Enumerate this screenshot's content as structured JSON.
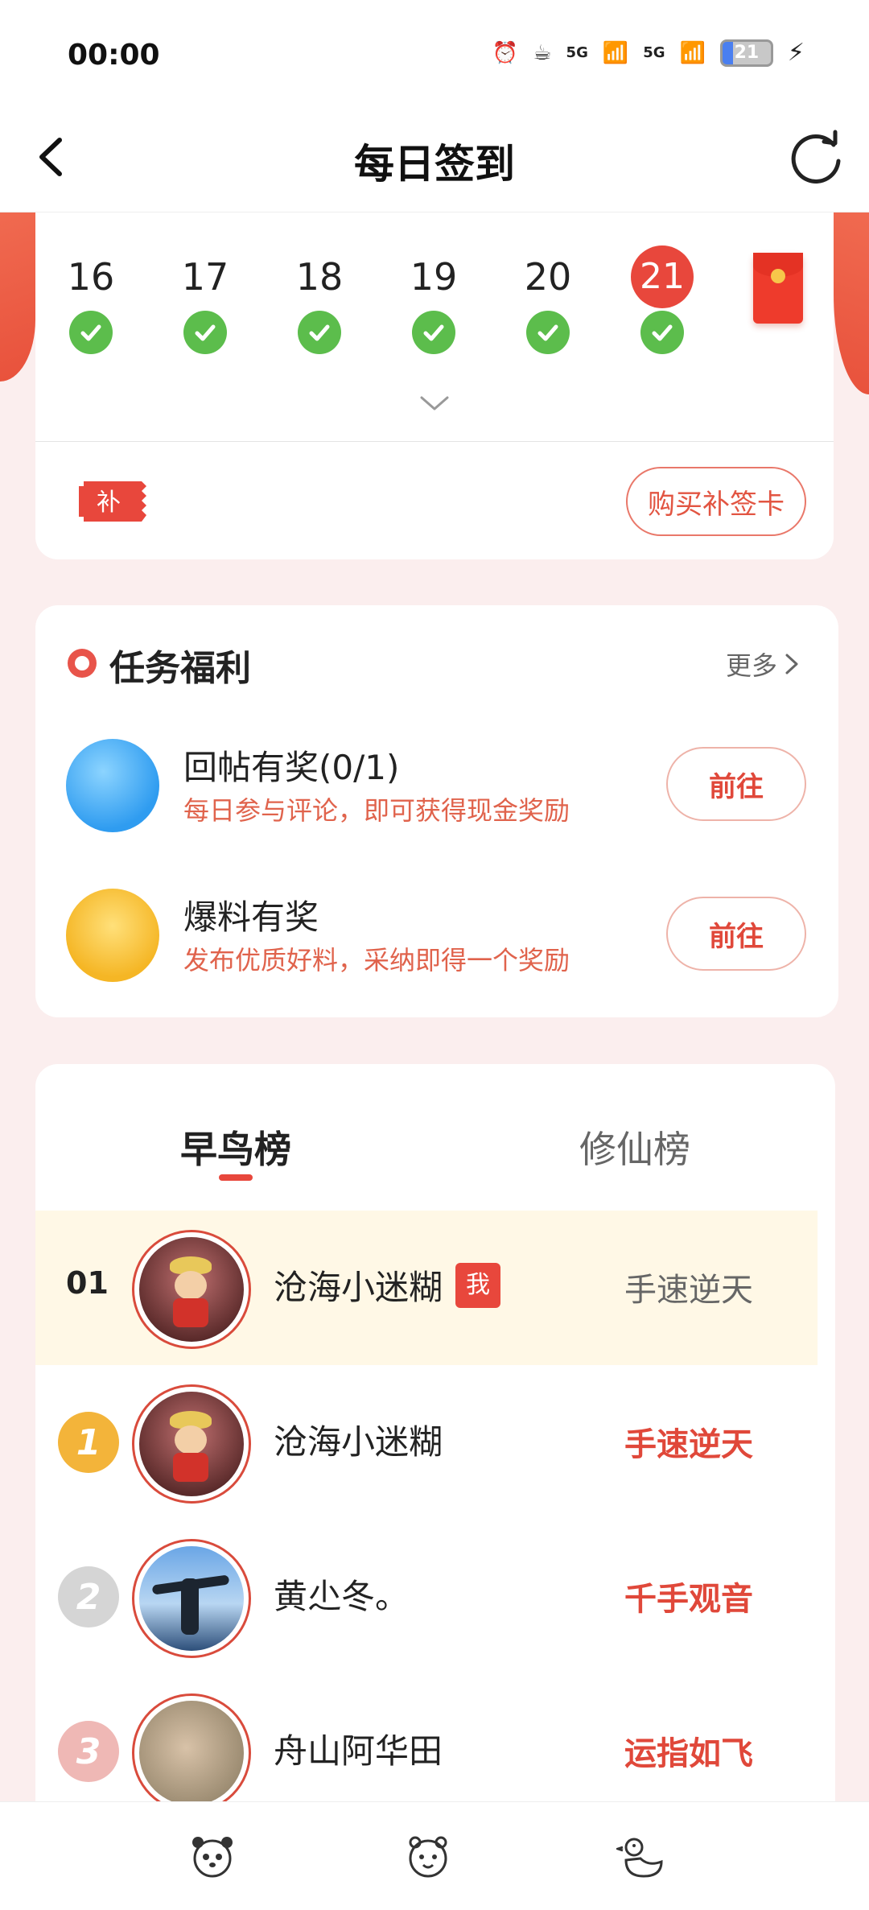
{
  "status_bar": {
    "time": "00:00",
    "network_1": "5G",
    "network_2": "5G",
    "battery": "21"
  },
  "nav": {
    "title": "每日签到"
  },
  "calendar": {
    "days": [
      {
        "num": "16",
        "checked": true
      },
      {
        "num": "17",
        "checked": true
      },
      {
        "num": "18",
        "checked": true
      },
      {
        "num": "19",
        "checked": true
      },
      {
        "num": "20",
        "checked": true
      },
      {
        "num": "21",
        "checked": true,
        "today": true
      }
    ],
    "buqian_icon_label": "补",
    "buy_card_label": "购买补签卡"
  },
  "tasks": {
    "title": "任务福利",
    "more_label": "更多",
    "items": [
      {
        "name": "回帖有奖(0/1)",
        "desc": "每日参与评论，即可获得现金奖励",
        "button": "前往",
        "icon": "reply-reward-icon"
      },
      {
        "name": "爆料有奖",
        "desc": "发布优质好料，采纳即得一个奖励",
        "button": "前往",
        "icon": "money-bag-icon"
      }
    ]
  },
  "ranking": {
    "tabs": [
      "早鸟榜",
      "修仙榜"
    ],
    "active_tab": 0,
    "me": {
      "rank": "01",
      "name": "沧海小迷糊",
      "badge": "我",
      "title": "手速逆天"
    },
    "rows": [
      {
        "medal": "1",
        "name": "沧海小迷糊",
        "title": "手速逆天"
      },
      {
        "medal": "2",
        "name": "黄尐冬。",
        "title": "千手观音"
      },
      {
        "medal": "3",
        "name": "舟山阿华田",
        "title": "运指如飞"
      }
    ]
  },
  "colors": {
    "accent": "#e8473c",
    "check": "#5cbd4c",
    "desc": "#e0634c"
  }
}
